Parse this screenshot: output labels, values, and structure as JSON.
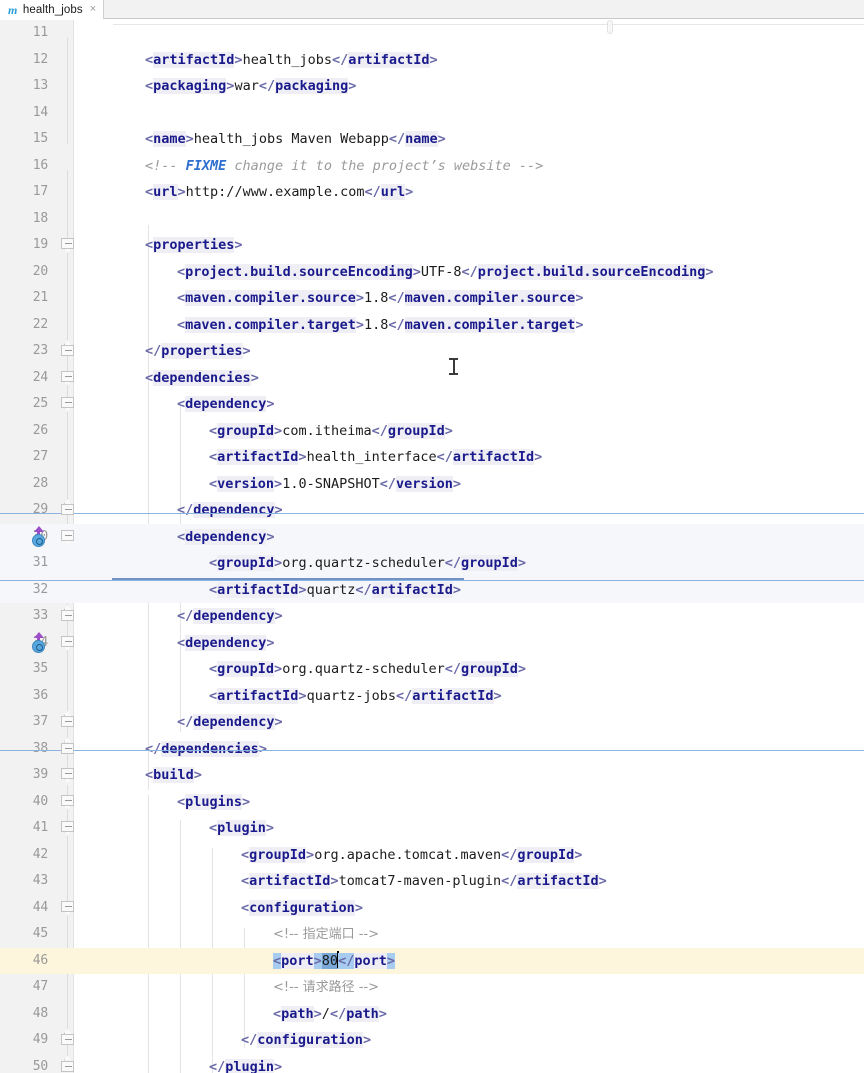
{
  "window": {
    "app": "intellij-idea-editor",
    "colors": {
      "tag": "#1a1a8c",
      "bracket": "#6a6aa8",
      "comment": "#9a9a9a",
      "fixme": "#2f6fd0",
      "selection": "#a8ccf0",
      "selection_strong": "#7aa8d8",
      "current_line": "#fdf6dd",
      "gutter": "#f2f2f2",
      "block_highlight": "#f6f7fa",
      "block_rule": "#8cb4e0",
      "dep_arrow": "#9b4dca",
      "dep_circle": "#5aa8e0"
    }
  },
  "tabbar": {
    "tabs": [
      {
        "label": "health_jobs",
        "icon": "maven-m-icon",
        "close": "×",
        "active": true
      }
    ]
  },
  "editor": {
    "file": "pom.xml",
    "first_visible_line": 11,
    "current_line": 46,
    "selection_text": "<port>80</port>",
    "lines": [
      {
        "n": 11,
        "indent": 0,
        "kind": "blank",
        "text": ""
      },
      {
        "n": 12,
        "indent": 1,
        "kind": "element",
        "tag": "artifactId",
        "value": "health_jobs"
      },
      {
        "n": 13,
        "indent": 1,
        "kind": "element",
        "tag": "packaging",
        "value": "war"
      },
      {
        "n": 14,
        "indent": 0,
        "kind": "blank",
        "text": ""
      },
      {
        "n": 15,
        "indent": 1,
        "kind": "element",
        "tag": "name",
        "value": "health_jobs Maven Webapp"
      },
      {
        "n": 16,
        "indent": 1,
        "kind": "comment-fixme",
        "prefix": "<!-- ",
        "keyword": "FIXME",
        "rest": " change it to the project’s website ",
        "suffix": "-->"
      },
      {
        "n": 17,
        "indent": 1,
        "kind": "element",
        "tag": "url",
        "value": "http://www.example.com"
      },
      {
        "n": 18,
        "indent": 0,
        "kind": "blank",
        "text": ""
      },
      {
        "n": 19,
        "indent": 1,
        "kind": "open",
        "tag": "properties"
      },
      {
        "n": 20,
        "indent": 2,
        "kind": "element",
        "tag": "project.build.sourceEncoding",
        "value": "UTF-8"
      },
      {
        "n": 21,
        "indent": 2,
        "kind": "element",
        "tag": "maven.compiler.source",
        "value": "1.8"
      },
      {
        "n": 22,
        "indent": 2,
        "kind": "element",
        "tag": "maven.compiler.target",
        "value": "1.8"
      },
      {
        "n": 23,
        "indent": 1,
        "kind": "close",
        "tag": "properties"
      },
      {
        "n": 24,
        "indent": 1,
        "kind": "open",
        "tag": "dependencies"
      },
      {
        "n": 25,
        "indent": 2,
        "kind": "open",
        "tag": "dependency"
      },
      {
        "n": 26,
        "indent": 3,
        "kind": "element",
        "tag": "groupId",
        "value": "com.itheima"
      },
      {
        "n": 27,
        "indent": 3,
        "kind": "element",
        "tag": "artifactId",
        "value": "health_interface"
      },
      {
        "n": 28,
        "indent": 3,
        "kind": "element",
        "tag": "version",
        "value": "1.0-SNAPSHOT"
      },
      {
        "n": 29,
        "indent": 2,
        "kind": "close",
        "tag": "dependency"
      },
      {
        "n": 30,
        "indent": 2,
        "kind": "open",
        "tag": "dependency"
      },
      {
        "n": 31,
        "indent": 3,
        "kind": "element",
        "tag": "groupId",
        "value": "org.quartz-scheduler"
      },
      {
        "n": 32,
        "indent": 3,
        "kind": "element",
        "tag": "artifactId",
        "value": "quartz"
      },
      {
        "n": 33,
        "indent": 2,
        "kind": "close",
        "tag": "dependency"
      },
      {
        "n": 34,
        "indent": 2,
        "kind": "open",
        "tag": "dependency"
      },
      {
        "n": 35,
        "indent": 3,
        "kind": "element",
        "tag": "groupId",
        "value": "org.quartz-scheduler"
      },
      {
        "n": 36,
        "indent": 3,
        "kind": "element",
        "tag": "artifactId",
        "value": "quartz-jobs"
      },
      {
        "n": 37,
        "indent": 2,
        "kind": "close",
        "tag": "dependency"
      },
      {
        "n": 38,
        "indent": 1,
        "kind": "close",
        "tag": "dependencies"
      },
      {
        "n": 39,
        "indent": 1,
        "kind": "open",
        "tag": "build"
      },
      {
        "n": 40,
        "indent": 2,
        "kind": "open",
        "tag": "plugins"
      },
      {
        "n": 41,
        "indent": 3,
        "kind": "open",
        "tag": "plugin"
      },
      {
        "n": 42,
        "indent": 4,
        "kind": "element",
        "tag": "groupId",
        "value": "org.apache.tomcat.maven"
      },
      {
        "n": 43,
        "indent": 4,
        "kind": "element",
        "tag": "artifactId",
        "value": "tomcat7-maven-plugin"
      },
      {
        "n": 44,
        "indent": 4,
        "kind": "open",
        "tag": "configuration"
      },
      {
        "n": 45,
        "indent": 5,
        "kind": "comment",
        "text": "<!-- 指定端口 -->"
      },
      {
        "n": 46,
        "indent": 5,
        "kind": "element-selected",
        "tag": "port",
        "value": "80"
      },
      {
        "n": 47,
        "indent": 5,
        "kind": "comment",
        "text": "<!-- 请求路径 -->"
      },
      {
        "n": 48,
        "indent": 5,
        "kind": "element",
        "tag": "path",
        "value": "/"
      },
      {
        "n": 49,
        "indent": 4,
        "kind": "close",
        "tag": "configuration"
      },
      {
        "n": 50,
        "indent": 3,
        "kind": "close",
        "tag": "plugin"
      }
    ]
  },
  "gutter": {
    "dependency_update_icons": [
      {
        "line": 30,
        "name": "dependency-update-available-icon"
      },
      {
        "line": 34,
        "name": "dependency-update-available-icon"
      }
    ],
    "fold_markers_down": [
      19,
      24,
      25,
      30,
      34,
      39,
      40,
      41,
      44
    ],
    "fold_markers_up": [
      23,
      29,
      33,
      37,
      38,
      49,
      50
    ]
  }
}
